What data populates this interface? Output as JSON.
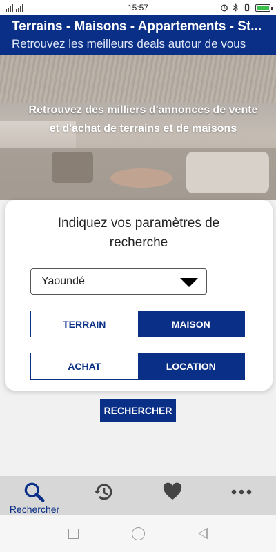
{
  "status_bar": {
    "time": "15:57",
    "icons": [
      "signal-icon",
      "alarm-icon",
      "bluetooth-icon",
      "vibrate-icon",
      "battery-icon"
    ]
  },
  "header": {
    "title": "Terrains - Maisons - Appartements - St...",
    "subtitle": "Retrouvez les meilleurs deals autour de vous"
  },
  "hero": {
    "text": "Retrouvez des milliers d'annonces de vente et d'achat de terrains et de maisons"
  },
  "search_card": {
    "title": "Indiquez vos paramètres de recherche",
    "city": "Yaoundé",
    "type_options": [
      {
        "label": "TERRAIN",
        "selected": false
      },
      {
        "label": "MAISON",
        "selected": true
      }
    ],
    "transaction_options": [
      {
        "label": "ACHAT",
        "selected": false
      },
      {
        "label": "LOCATION",
        "selected": true
      }
    ],
    "search_button": "RECHERCHER"
  },
  "tab_bar": {
    "items": [
      {
        "label": "Rechercher",
        "icon": "search-icon",
        "active": true
      },
      {
        "label": "",
        "icon": "history-icon",
        "active": false
      },
      {
        "label": "",
        "icon": "heart-icon",
        "active": false
      },
      {
        "label": "",
        "icon": "more-icon",
        "active": false
      }
    ]
  },
  "colors": {
    "primary": "#0a2f86",
    "tab_bar_bg": "#d7d7d7",
    "battery": "#3bbf4a"
  }
}
